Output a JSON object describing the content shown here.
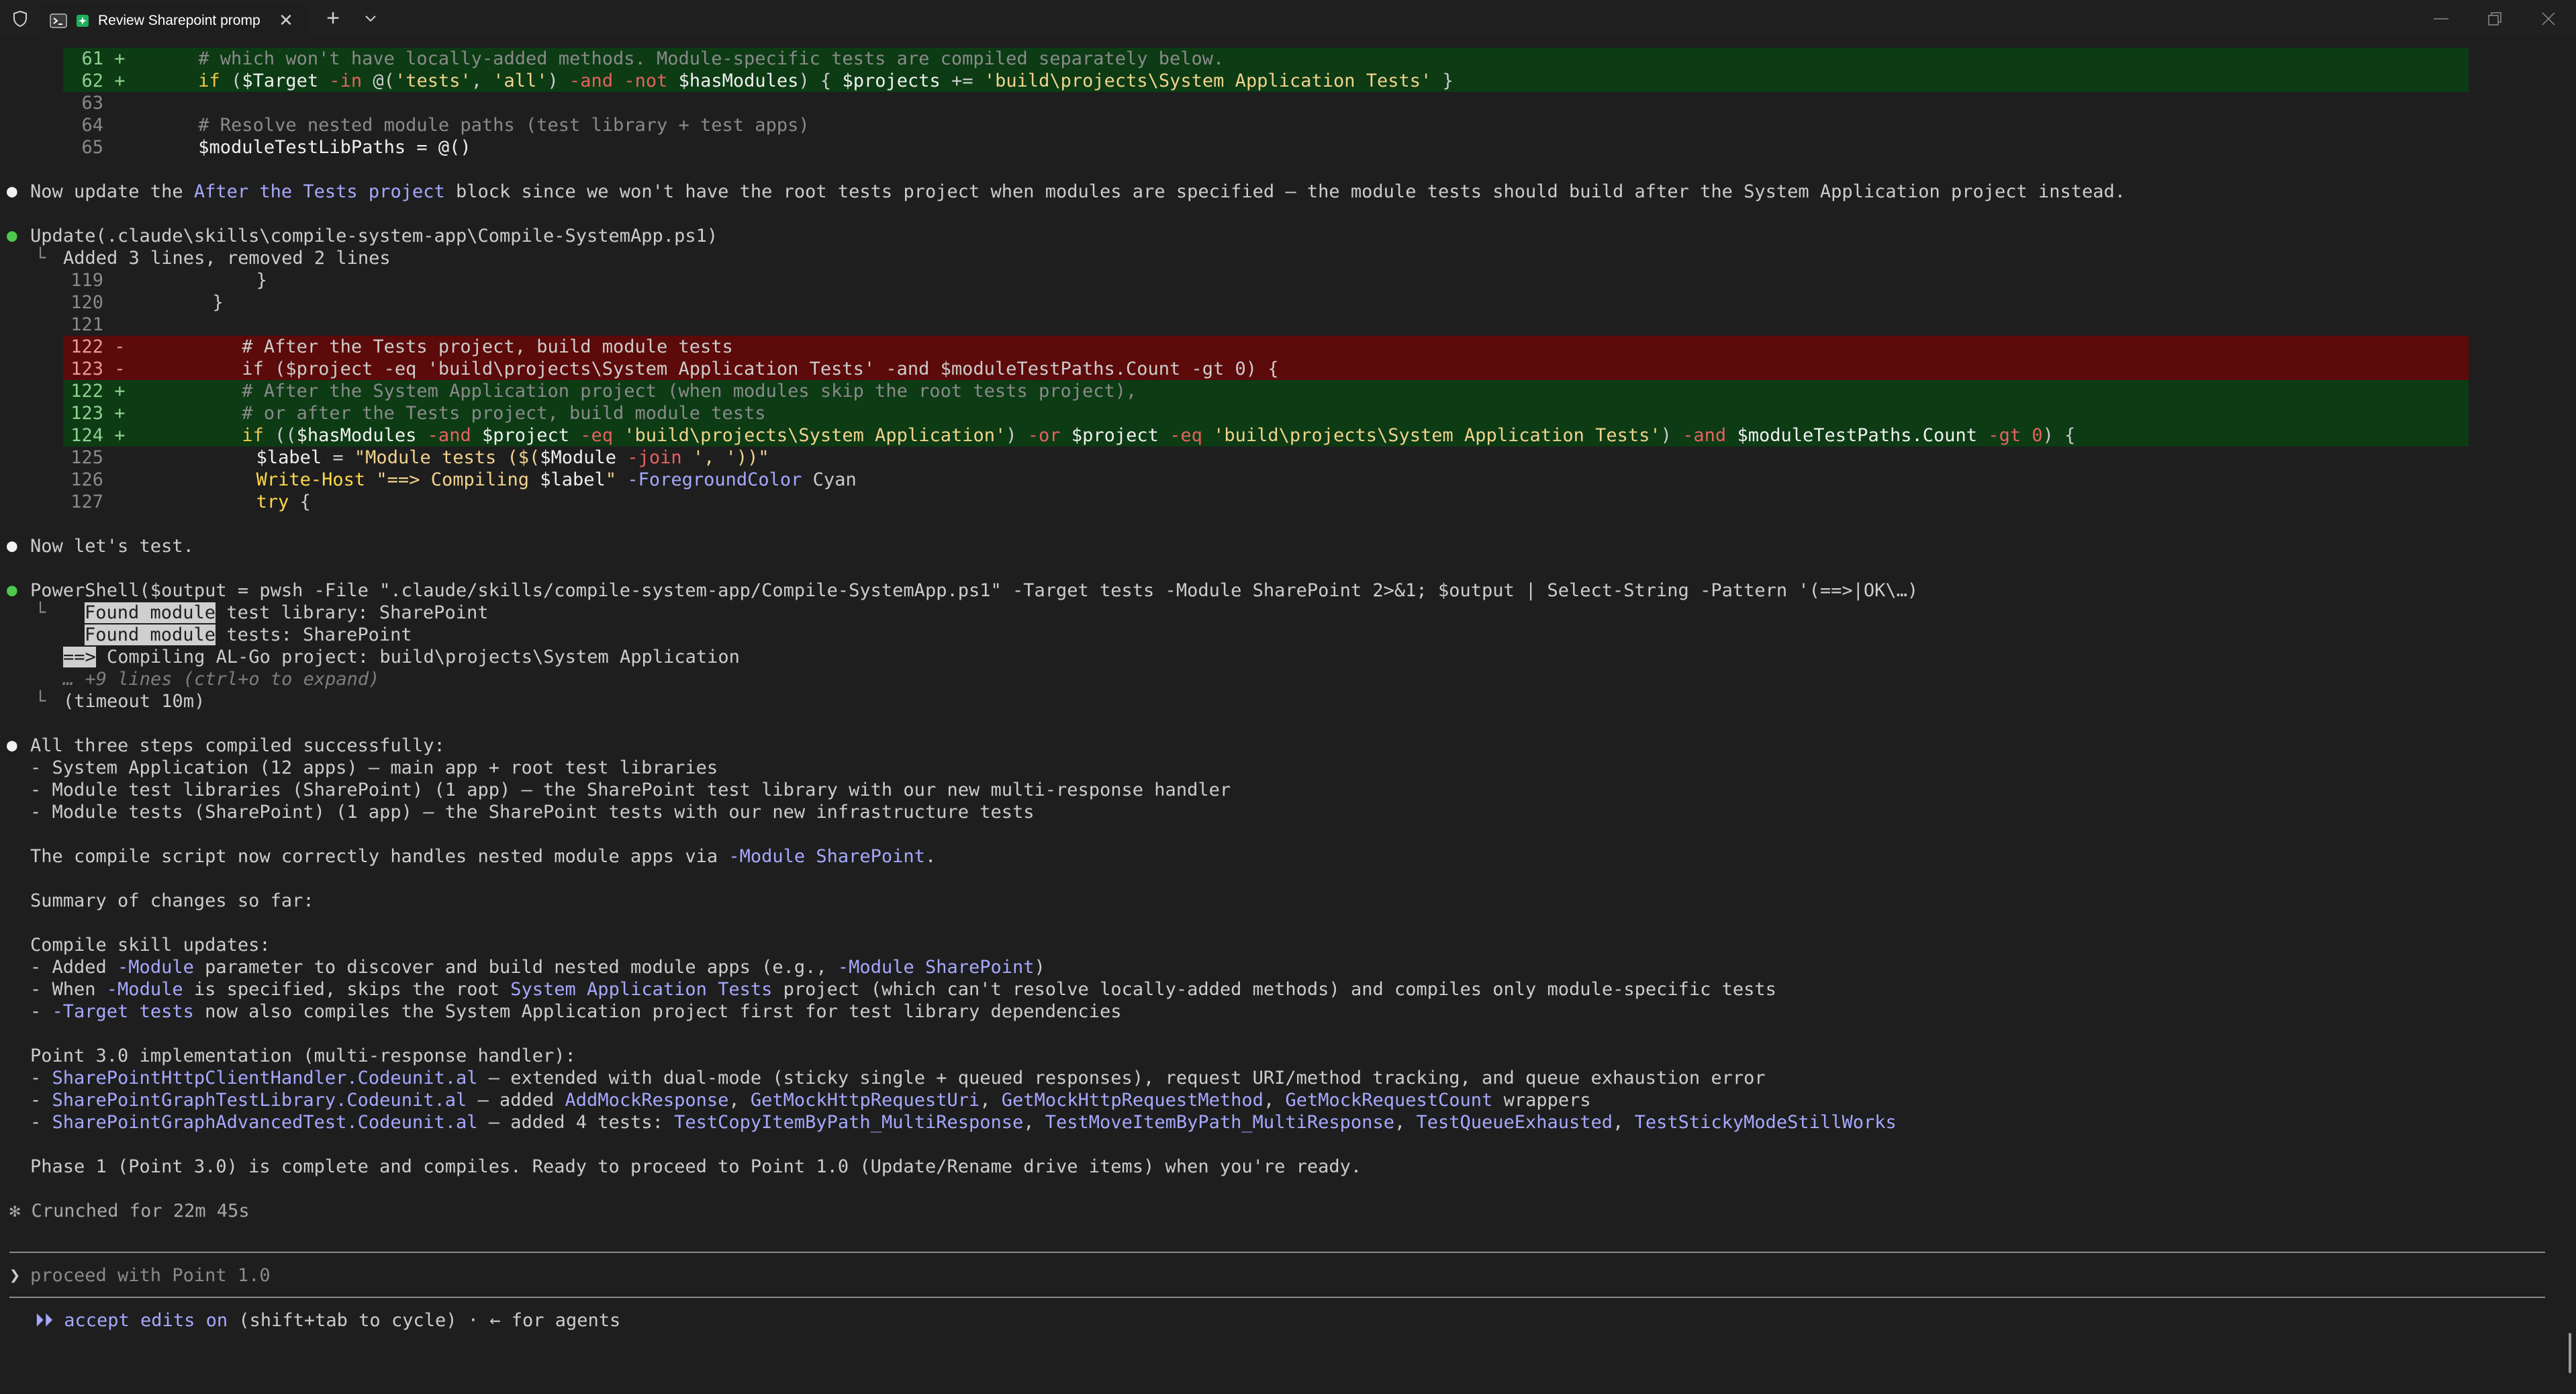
{
  "window": {
    "tab_title": "Review Sharepoint promp",
    "tab_close": "✕",
    "new_tab": "+",
    "dropdown": "⌄",
    "minimize": "—",
    "restore": "❐",
    "close": "✕"
  },
  "diff1": {
    "lines": [
      {
        "num": "61",
        "sign": "+",
        "code": "    # which won't have locally-added methods. Module-specific tests are compiled separately below."
      },
      {
        "num": "62",
        "sign": "+",
        "c1": "    ",
        "kw1": "if",
        "c2": " (",
        "v1": "$Target",
        "o1": " -in",
        "c3": " @(",
        "s1": "'tests'",
        "c4": ", ",
        "s2": "'all'",
        "c5": ") ",
        "o2": "-and -not",
        "c6": " ",
        "v2": "$hasModules",
        "c7": ") { ",
        "v3": "$projects",
        "c8": " += ",
        "s3": "'build\\projects\\System Application Tests'",
        "c9": " }"
      },
      {
        "num": "63",
        "sign": "",
        "code": ""
      },
      {
        "num": "64",
        "sign": "",
        "code": "    # Resolve nested module paths (test library + test apps)"
      },
      {
        "num": "65",
        "sign": "",
        "code": "    $moduleTestLibPaths = @()"
      }
    ]
  },
  "msg1": {
    "prefix": "Now update the ",
    "link": "After the Tests project",
    "suffix": " block since we won't have the root tests project when modules are specified — the module tests should build after the System Application project instead."
  },
  "update_call": {
    "tool": "Update(.claude\\skills\\compile-system-app\\Compile-SystemApp.ps1)",
    "summary": "Added 3 lines, removed 2 lines"
  },
  "diff2": {
    "context_top": [
      {
        "num": "119",
        "code": "            }"
      },
      {
        "num": "120",
        "code": "        }"
      },
      {
        "num": "121",
        "code": ""
      }
    ],
    "removed": [
      {
        "num": "122",
        "sign": "-",
        "code": "        # After the Tests project, build module tests"
      },
      {
        "num": "123",
        "sign": "-",
        "code": "        if ($project -eq 'build\\projects\\System Application Tests' -and $moduleTestPaths.Count -gt 0) {"
      }
    ],
    "added": [
      {
        "num": "122",
        "sign": "+",
        "code": "        # After the System Application project (when modules skip the root tests project),"
      },
      {
        "num": "123",
        "sign": "+",
        "code": "        # or after the Tests project, build module tests"
      },
      {
        "num": "124",
        "sign": "+",
        "c1": "        ",
        "kw": "if",
        "c2": " ((",
        "v1": "$hasModules",
        "o1": " -and ",
        "v2": "$project",
        "o2": " -eq ",
        "s1": "'build\\projects\\System Application'",
        "c3": ") ",
        "o3": "-or",
        "c4": " ",
        "v3": "$project",
        "o4": " -eq ",
        "s2": "'build\\projects\\System Application Tests'",
        "c5": ") ",
        "o5": "-and",
        "c6": " ",
        "v4": "$moduleTestPaths.Count",
        "o6": " -gt ",
        "n": "0",
        "c7": ") {"
      }
    ],
    "context_bottom": [
      {
        "num": "125",
        "c1": "            ",
        "v1": "$label",
        "c2": " = ",
        "s1": "\"Module tests ($(",
        "v2": "$Module",
        "o1": " -join ",
        "s2": "', '",
        "s3": "))\""
      },
      {
        "num": "126",
        "c1": "            ",
        "kw": "Write-Host",
        "c2": " ",
        "s1": "\"==> Compiling ",
        "v1": "$label",
        "s2": "\"",
        "o1": " -ForegroundColor",
        "c3": " Cyan"
      },
      {
        "num": "127",
        "c1": "            ",
        "kw": "try",
        "c2": " {"
      }
    ]
  },
  "msg2": "Now let's test.",
  "ps_call": {
    "tool": "PowerShell($output = pwsh -File \".claude/skills/compile-system-app/Compile-SystemApp.ps1\" -Target tests -Module SharePoint 2>&1; $output | Select-String -Pattern '(==>|OK\\…)",
    "out1_hl": "Found module",
    "out1_rest": " test library: SharePoint",
    "out2_hl": "Found module",
    "out2_rest": " tests: SharePoint",
    "out3_hl": "==>",
    "out3_rest": " Compiling AL-Go project: build\\projects\\System Application",
    "more": "… +9 lines (ctrl+o to expand)",
    "timeout": "(timeout 10m)"
  },
  "summary": {
    "header": "All three steps compiled successfully:",
    "items": [
      "- System Application (12 apps) — main app + root test libraries",
      "- Module test libraries (SharePoint) (1 app) — the SharePoint test library with our new multi-response handler",
      "- Module tests (SharePoint) (1 app) — the SharePoint tests with our new infrastructure tests"
    ],
    "nested_prefix": "The compile script now correctly handles nested module apps via ",
    "nested_link": "-Module SharePoint",
    "nested_suffix": ".",
    "changes_header": "Summary of changes so far:",
    "skill_header": "Compile skill updates:",
    "skill_1a": "- Added ",
    "skill_1b": "-Module",
    "skill_1c": " parameter to discover and build nested module apps (e.g., ",
    "skill_1d": "-Module SharePoint",
    "skill_1e": ")",
    "skill_2a": "- When ",
    "skill_2b": "-Module",
    "skill_2c": " is specified, skips the root ",
    "skill_2d": "System Application Tests",
    "skill_2e": " project (which can't resolve locally-added methods) and compiles only module-specific tests",
    "skill_3a": "- ",
    "skill_3b": "-Target tests",
    "skill_3c": " now also compiles the System Application project first for test library dependencies",
    "point_header": "Point 3.0 implementation (multi-response handler):",
    "p1a": "- ",
    "p1b": "SharePointHttpClientHandler.Codeunit.al",
    "p1c": " — extended with dual-mode (sticky single + queued responses), request URI/method tracking, and queue exhaustion error",
    "p2a": "- ",
    "p2b": "SharePointGraphTestLibrary.Codeunit.al",
    "p2c": " — added ",
    "p2d": "AddMockResponse",
    "p2e": ", ",
    "p2f": "GetMockHttpRequestUri",
    "p2g": ", ",
    "p2h": "GetMockHttpRequestMethod",
    "p2i": ", ",
    "p2j": "GetMockRequestCount",
    "p2k": " wrappers",
    "p3a": "- ",
    "p3b": "SharePointGraphAdvancedTest.Codeunit.al",
    "p3c": " — added 4 tests: ",
    "p3d": "TestCopyItemByPath_MultiResponse",
    "p3e": ", ",
    "p3f": "TestMoveItemByPath_MultiResponse",
    "p3g": ", ",
    "p3h": "TestQueueExhausted",
    "p3i": ", ",
    "p3j": "TestStickyModeStillWorks",
    "final": "Phase 1 (Point 3.0) is complete and compiles. Ready to proceed to Point 1.0 (Update/Rename drive items) when you're ready."
  },
  "status": "✻ Crunched for 22m 45s",
  "prompt": {
    "caret": "❯",
    "placeholder": "proceed with Point 1.0"
  },
  "footer": {
    "icon": "⏵⏵",
    "mode": "accept edits on",
    "hint": " (shift+tab to cycle) · ← for agents"
  },
  "colors": {
    "added_bg": "#0c3b14",
    "removed_bg": "#5c0a0a",
    "link": "#a6a8ff",
    "bullet_green": "#4ec94e"
  }
}
